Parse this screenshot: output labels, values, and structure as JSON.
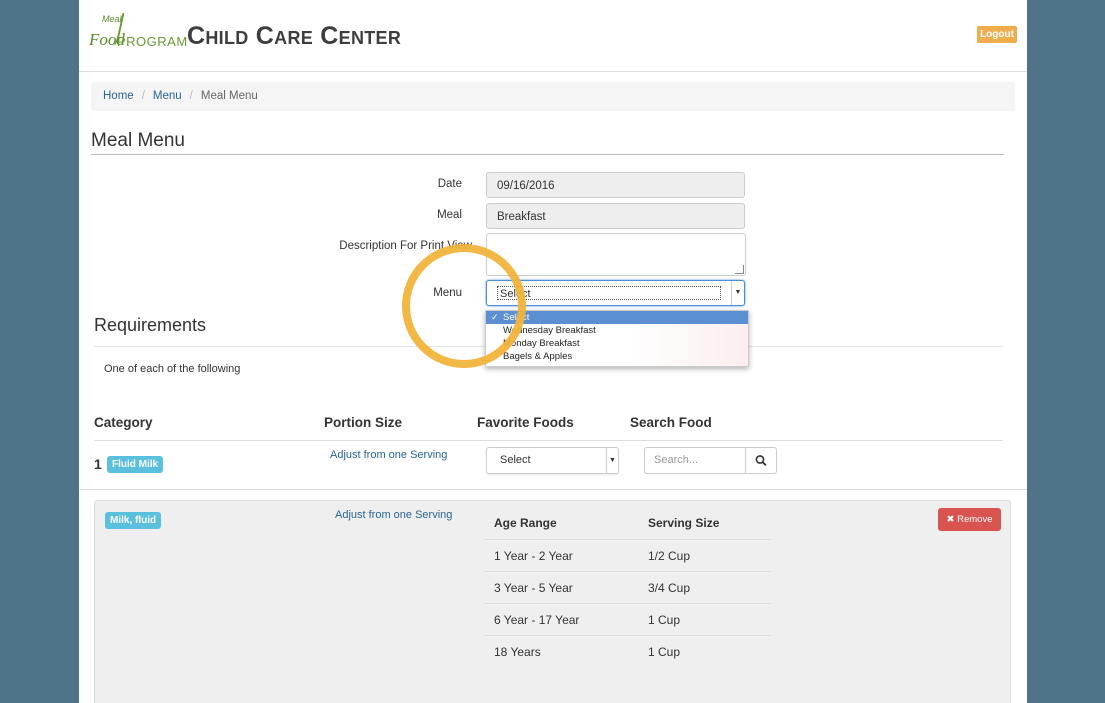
{
  "header": {
    "logo_top": "Meal",
    "logo_food": "Food",
    "logo_program": "PROGRAM",
    "title": "Child Care Center",
    "logout_label": "Logout"
  },
  "breadcrumb": {
    "home": "Home",
    "menu": "Menu",
    "current": "Meal Menu",
    "separator": "/"
  },
  "page_title": "Meal Menu",
  "form": {
    "date_label": "Date",
    "date_value": "09/16/2016",
    "meal_label": "Meal",
    "meal_value": "Breakfast",
    "description_label": "Description For Print View",
    "menu_label": "Menu",
    "menu_selected": "Select",
    "menu_options": [
      "Select",
      "Wednesday Breakfast",
      "Monday Breakfast",
      "Bagels & Apples"
    ]
  },
  "requirements": {
    "title": "Requirements",
    "text": "One of each of the following",
    "columns": [
      "Category",
      "Portion Size",
      "Favorite Foods",
      "Search Food"
    ],
    "row": {
      "number": "1",
      "category_badge": "Fluid Milk",
      "portion_link": "Adjust from one Serving",
      "favorite_selected": "Select",
      "search_placeholder": "Search..."
    }
  },
  "food_item": {
    "badge": "Milk, fluid",
    "portion_link": "Adjust from one Serving",
    "remove_label": "Remove",
    "table_headers": [
      "Age Range",
      "Serving Size"
    ],
    "table_rows": [
      [
        "1 Year - 2 Year",
        "1/2 Cup"
      ],
      [
        "3 Year - 5 Year",
        "3/4 Cup"
      ],
      [
        "6 Year - 17 Year",
        "1 Cup"
      ],
      [
        "18 Years",
        "1 Cup"
      ]
    ]
  },
  "colors": {
    "background": "#4f7389",
    "logout": "#f0ad4e",
    "badge": "#5bc0de",
    "remove": "#d9534f",
    "highlight": "#f0b43c"
  }
}
